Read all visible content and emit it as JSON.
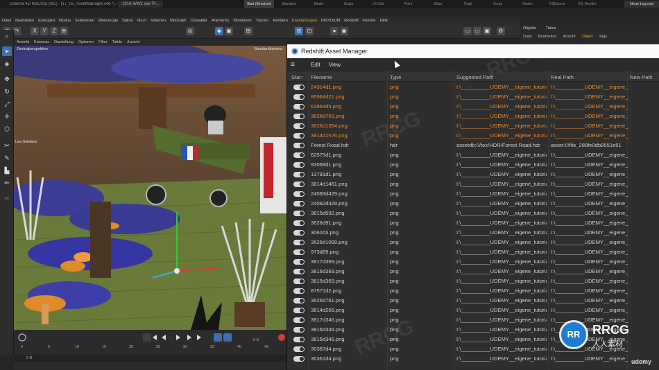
{
  "app": {
    "window_title": "Cinema 4D R25.015 (RC) - [17_02_AssetManager.c4d *] - Main",
    "doc_tab": "1916-WW1 war Pl...",
    "layout_tabs": [
      "Start (Benutzer)",
      "Standard",
      "Model",
      "Sculpt",
      "UV Edit",
      "Paint",
      "Gitter",
      "Track",
      "Script",
      "Nodes",
      "RSCourse (Benutzer)",
      "RS_Render (Benutzer)"
    ],
    "neue_layouts": "Neue Layouts"
  },
  "menubar": [
    "Datei",
    "Bearbeiten",
    "Erzeugen",
    "Modus",
    "Selektieren",
    "Werkzeuge",
    "Spline",
    "Mesh",
    "Volumen",
    "MoGraph",
    "Charakter",
    "Animieren",
    "Simulieren",
    "Tracker",
    "Rendern",
    "Erweiterungen",
    "INSYDIUM",
    "Redshift",
    "Fenster",
    "Hilfe"
  ],
  "viewport": {
    "menu": [
      "Ansicht",
      "Kameras",
      "Darstellung",
      "Optionen",
      "Filter",
      "Tafeln",
      "Ansicht"
    ],
    "label_left": "Zentralperspektive",
    "label_right": "Standardkamera",
    "label_tool": "Live-Selektion"
  },
  "timeline": {
    "ticks": [
      "0",
      "5",
      "10",
      "15",
      "20",
      "25",
      "30",
      "35",
      "40",
      "45"
    ],
    "frame_left": "0 B",
    "frame_right": "0 B"
  },
  "objects_panel": {
    "tabs": [
      "Objekte",
      "Takes"
    ],
    "menu": [
      "Datei",
      "Bearbeiten",
      "Ansicht",
      "Objekt",
      "Tags"
    ]
  },
  "asset_manager": {
    "title": "Redshift Asset Manager",
    "menu": [
      "Edit",
      "View"
    ],
    "columns": [
      "Stat↑",
      "Filename",
      "Type",
      "Suggested Path",
      "Real Path",
      "New Path"
    ],
    "rows": [
      {
        "file": "24314d1.png",
        "type": "png",
        "suggested": "I:\\__________UDEMY__eigene_tutoria",
        "real": "I:\\__________UDEMY__eigene_",
        "highlight": true
      },
      {
        "file": "85984d21.png",
        "type": "png",
        "suggested": "I:\\__________UDEMY__eigene_tutoria",
        "real": "I:\\__________UDEMY__eigene_",
        "highlight": true
      },
      {
        "file": "63864d5.png",
        "type": "png",
        "suggested": "I:\\__________UDEMY__eigene_tutoria",
        "real": "I:\\__________UDEMY__eigene_",
        "highlight": true
      },
      {
        "file": "3626d765.png",
        "type": "png",
        "suggested": "I:\\__________UDEMY__eigene_tutoria",
        "real": "I:\\__________UDEMY__eigene_",
        "highlight": true
      },
      {
        "file": "3626d1354.png",
        "type": "png",
        "suggested": "I:\\__________UDEMY__eigene_tutoria",
        "real": "I:\\__________UDEMY__eigene_",
        "highlight": true
      },
      {
        "file": "3814d1676.png",
        "type": "png",
        "suggested": "I:\\__________UDEMY__eigene_tutoria",
        "real": "I:\\__________UDEMY__eigene_",
        "highlight": true
      },
      {
        "file": "Forest Road.hdr",
        "type": "hdr",
        "suggested": "assetdb:///tex/HDR/Forest Road.hdr",
        "real": "asset:///file_288fe0db9551e51",
        "highlight": false
      },
      {
        "file": "62575d1.png",
        "type": "png",
        "suggested": "I:\\__________UDEMY__eigene_tutoria",
        "real": "I:\\__________UDEMY__eigene_",
        "highlight": false
      },
      {
        "file": "93068d1.png",
        "type": "png",
        "suggested": "I:\\__________UDEMY__eigene_tutoria",
        "real": "I:\\__________UDEMY__eigene_",
        "highlight": false
      },
      {
        "file": "13791d1.png",
        "type": "png",
        "suggested": "I:\\__________UDEMY__eigene_tutoria",
        "real": "I:\\__________UDEMY__eigene_",
        "highlight": false
      },
      {
        "file": "3814d1461.png",
        "type": "png",
        "suggested": "I:\\__________UDEMY__eigene_tutoria",
        "real": "I:\\__________UDEMY__eigene_",
        "highlight": false
      },
      {
        "file": "24083d429.png",
        "type": "png",
        "suggested": "I:\\__________UDEMY__eigene_tutoria",
        "real": "I:\\__________UDEMY__eigene_",
        "highlight": false
      },
      {
        "file": "24082d429.png",
        "type": "png",
        "suggested": "I:\\__________UDEMY__eigene_tutoria",
        "real": "I:\\__________UDEMY__eigene_",
        "highlight": false
      },
      {
        "file": "3815d592.png",
        "type": "png",
        "suggested": "I:\\__________UDEMY__eigene_tutoria",
        "real": "I:\\__________UDEMY__eigene_",
        "highlight": false
      },
      {
        "file": "3626d91.png",
        "type": "png",
        "suggested": "I:\\__________UDEMY__eigene_tutoria",
        "real": "I:\\__________UDEMY__eigene_",
        "highlight": false
      },
      {
        "file": "3062d3.png",
        "type": "png",
        "suggested": "I:\\__________UDEMY__eigene_tutoria",
        "real": "I:\\__________UDEMY__eigene_",
        "highlight": false
      },
      {
        "file": "3626d1069.png",
        "type": "png",
        "suggested": "I:\\__________UDEMY__eigene_tutoria",
        "real": "I:\\__________UDEMY__eigene_",
        "highlight": false
      },
      {
        "file": "973d89.png",
        "type": "png",
        "suggested": "I:\\__________UDEMY__eigene_tutoria",
        "real": "I:\\__________UDEMY__eigene_",
        "highlight": false
      },
      {
        "file": "3817d369.png",
        "type": "png",
        "suggested": "I:\\__________UDEMY__eigene_tutoria",
        "real": "I:\\__________UDEMY__eigene_",
        "highlight": false
      },
      {
        "file": "3816d369.png",
        "type": "png",
        "suggested": "I:\\__________UDEMY__eigene_tutoria",
        "real": "I:\\__________UDEMY__eigene_",
        "highlight": false
      },
      {
        "file": "3815d369.png",
        "type": "png",
        "suggested": "I:\\__________UDEMY__eigene_tutoria",
        "real": "I:\\__________UDEMY__eigene_",
        "highlight": false
      },
      {
        "file": "87571d2.png",
        "type": "png",
        "suggested": "I:\\__________UDEMY__eigene_tutoria",
        "real": "I:\\__________UDEMY__eigene_",
        "highlight": false
      },
      {
        "file": "3626d761.png",
        "type": "png",
        "suggested": "I:\\__________UDEMY__eigene_tutoria",
        "real": "I:\\__________UDEMY__eigene_",
        "highlight": false
      },
      {
        "file": "3814d266.png",
        "type": "png",
        "suggested": "I:\\__________UDEMY__eigene_tutoria",
        "real": "I:\\__________UDEMY__eigene_",
        "highlight": false
      },
      {
        "file": "3817d346.png",
        "type": "png",
        "suggested": "I:\\__________UDEMY__eigene_tutoria",
        "real": "I:\\__________UDEMY__eigene_",
        "highlight": false
      },
      {
        "file": "3816d346.png",
        "type": "png",
        "suggested": "I:\\__________UDEMY__eigene_tutoria",
        "real": "I:\\__________UDEMY__eigene_",
        "highlight": false
      },
      {
        "file": "3815d346.png",
        "type": "png",
        "suggested": "I:\\__________UDEMY__eigene_tutoria",
        "real": "I:\\__________UDEMY__eigene_",
        "highlight": false
      },
      {
        "file": "30367d4.png",
        "type": "png",
        "suggested": "I:\\__________UDEMY__eigene_tutoria",
        "real": "I:\\__________UDEMY__eigene_",
        "highlight": false
      },
      {
        "file": "30361d4.png",
        "type": "png",
        "suggested": "I:\\__________UDEMY__eigene_tutoria",
        "real": "I:\\__________UDEMY__eigene_",
        "highlight": false
      }
    ]
  },
  "branding": {
    "logo_text": "RRCG",
    "logo_sub": "人人素材",
    "badge": "RR",
    "platform": "udemy",
    "watermark": "RRCG"
  },
  "colors": {
    "accent_orange": "#f08a2c",
    "accent_blue": "#3d6fb0"
  }
}
